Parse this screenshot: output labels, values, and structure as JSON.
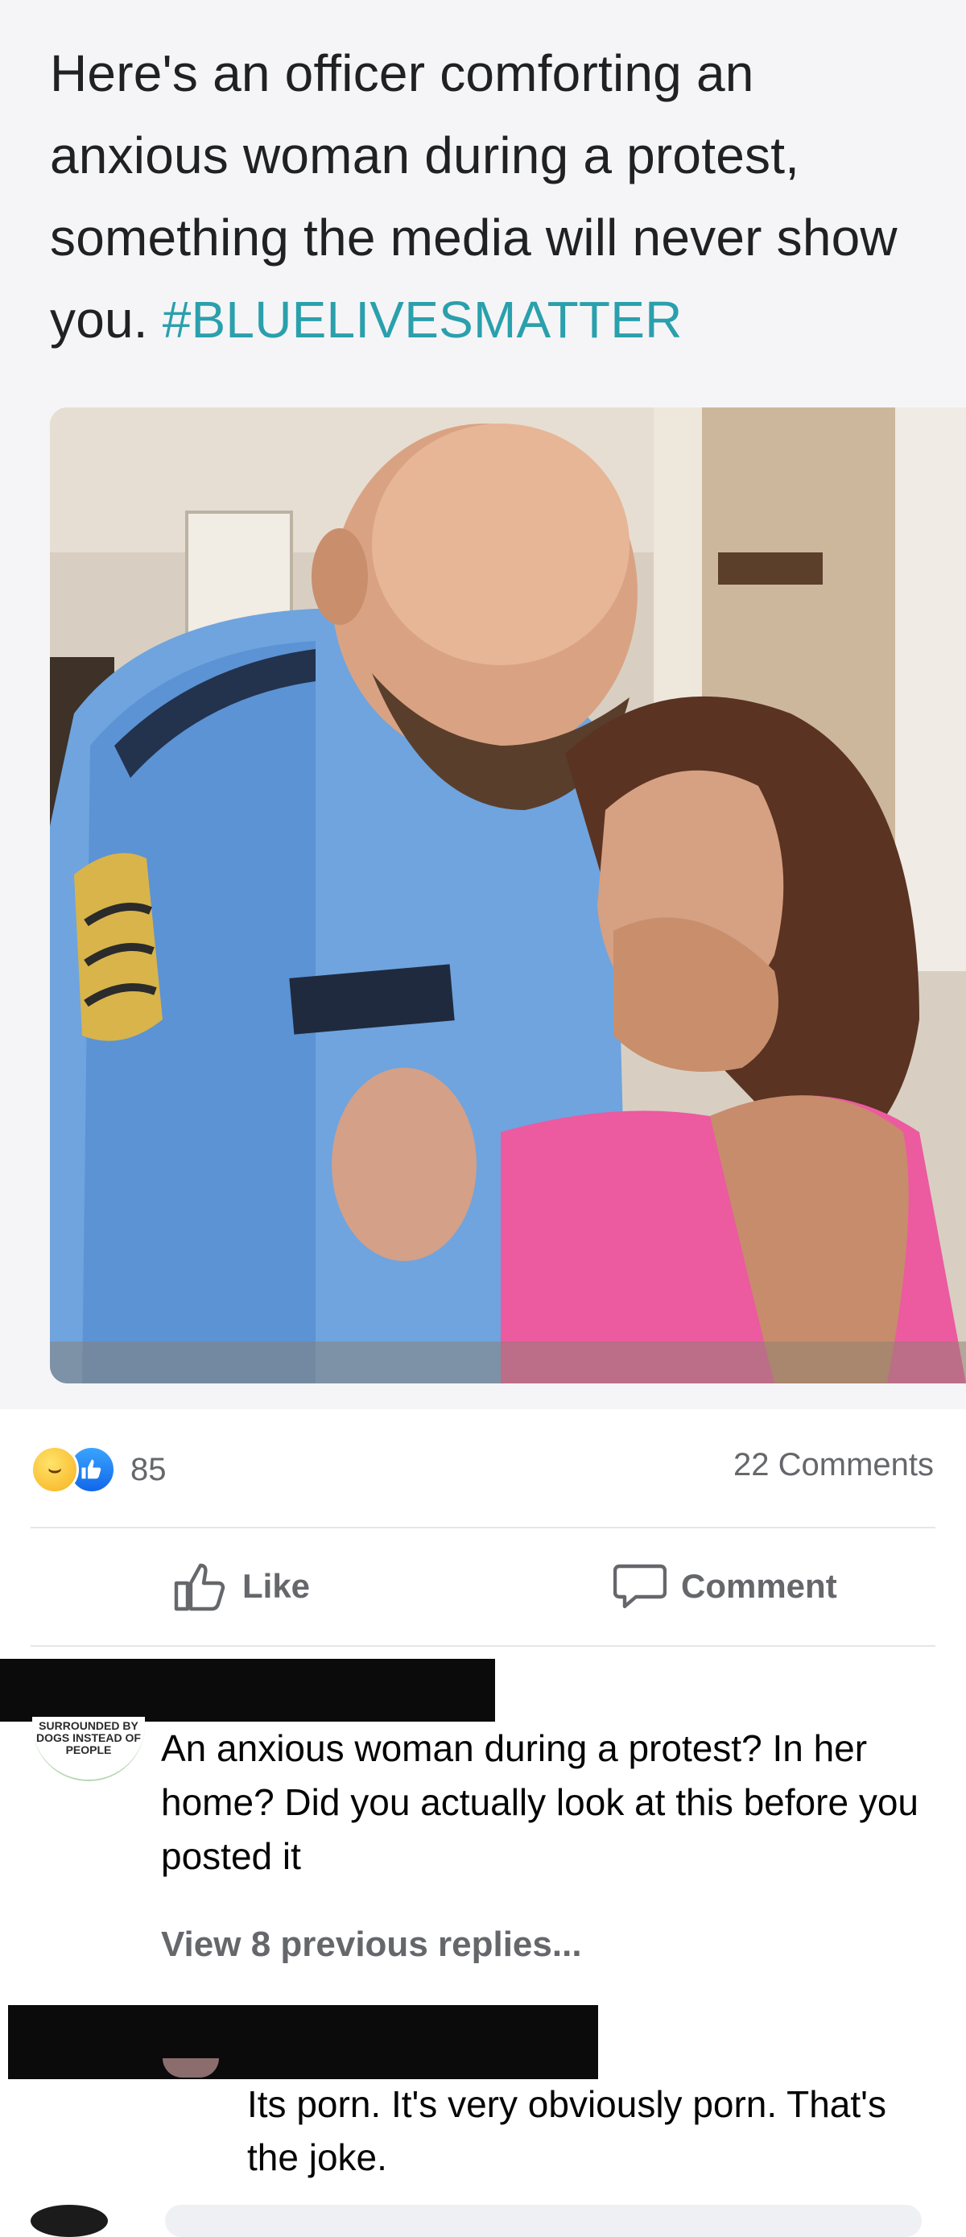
{
  "post": {
    "caption_text": "Here's an officer comforting an anxious woman during a protest, something the media will never show you. ",
    "hashtag": "#BLUELIVESMATTER",
    "photo_icon": "photo-image"
  },
  "reactions": {
    "icons": [
      "haha-reaction-icon",
      "like-reaction-icon"
    ],
    "count": "85",
    "comments_label": "22 Comments"
  },
  "actions": {
    "like_label": "Like",
    "comment_label": "Comment"
  },
  "comments": [
    {
      "avatar_text": "SURROUNDED BY DOGS INSTEAD OF PEOPLE",
      "text": "An anxious woman during a protest? In her home? Did you actually look at this before you posted it"
    }
  ],
  "replies": {
    "view_previous_label": "View 8 previous replies...",
    "items": [
      {
        "text": "Its porn. It's very obviously porn. That's the joke."
      }
    ]
  },
  "colors": {
    "hashtag": "#2aa0ac",
    "secondary_text": "#65676b",
    "background_top": "#f5f5f7",
    "redaction": "#0b0b0b"
  }
}
